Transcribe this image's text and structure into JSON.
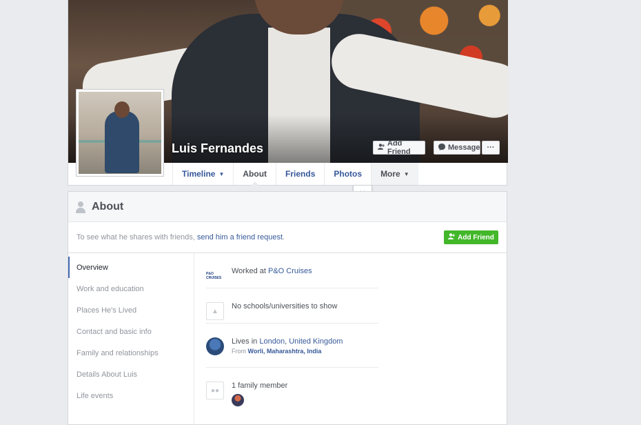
{
  "profile": {
    "name": "Luis Fernandes",
    "buttons": {
      "add_friend": "Add Friend",
      "message": "Message",
      "more": "···"
    }
  },
  "tabs": [
    {
      "label": "Timeline",
      "has_caret": true
    },
    {
      "label": "About",
      "active": true
    },
    {
      "label": "Friends"
    },
    {
      "label": "Photos"
    },
    {
      "label": "More",
      "has_caret": true
    }
  ],
  "about": {
    "title": "About",
    "notice_prefix": "To see what he shares with friends, ",
    "notice_link": "send him a friend request",
    "notice_suffix": ".",
    "notice_button": "Add Friend",
    "nav": [
      {
        "label": "Overview",
        "active": true
      },
      {
        "label": "Work and education"
      },
      {
        "label": "Places He's Lived"
      },
      {
        "label": "Contact and basic info"
      },
      {
        "label": "Family and relationships"
      },
      {
        "label": "Details About Luis"
      },
      {
        "label": "Life events"
      }
    ],
    "overview": {
      "work_prefix": "Worked at ",
      "work_link": "P&O Cruises",
      "work_logo": "P&O CRUISES",
      "education": "No schools/universities to show",
      "lives_prefix": "Lives in ",
      "lives_city": "London",
      "lives_sep": ", ",
      "lives_country": "United Kingdom",
      "from_prefix": "From ",
      "from_place": "Worli, Maharashtra, India",
      "family": "1 family member"
    }
  },
  "icons": {
    "add_friend": "person-plus-icon",
    "message": "messenger-icon",
    "about": "person-icon",
    "school": "graduation-cap-icon",
    "family": "people-icon"
  },
  "colors": {
    "link": "#365899",
    "green": "#42b72a",
    "background": "#e9ebee"
  }
}
